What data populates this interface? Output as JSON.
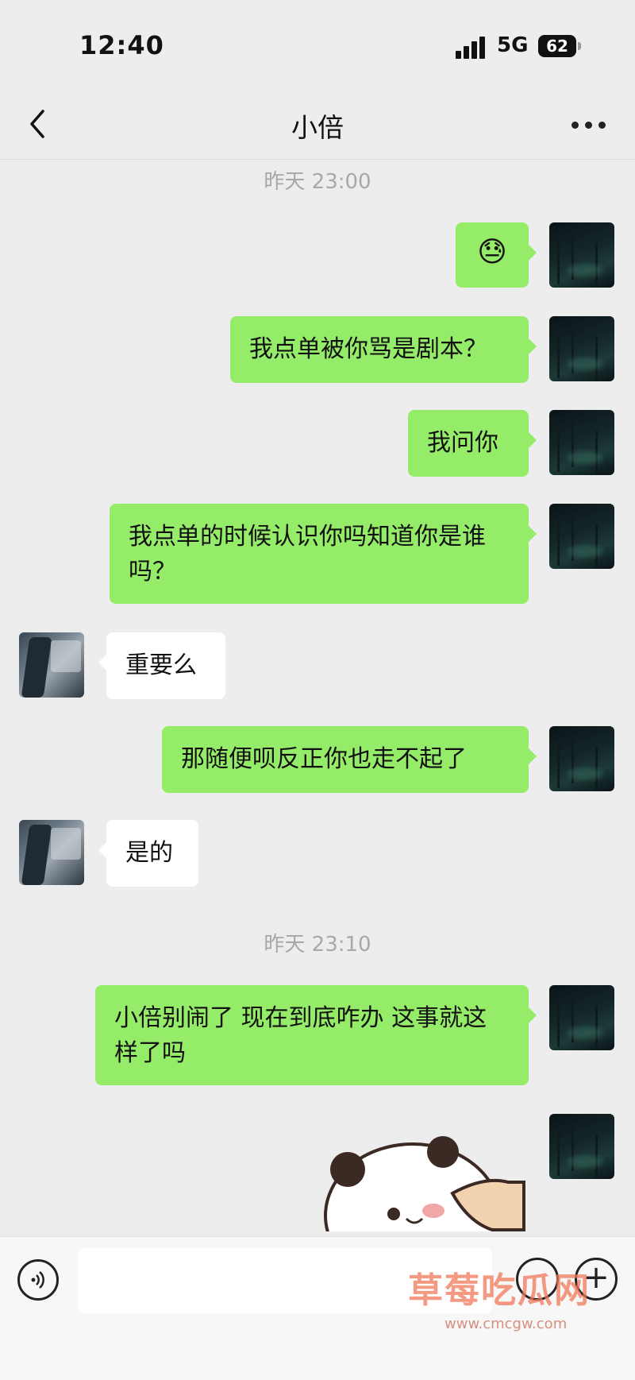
{
  "status_bar": {
    "time": "12:40",
    "network": "5G",
    "battery": "62"
  },
  "nav": {
    "title": "小倍",
    "back_icon": "chevron-left-icon",
    "more_icon": "more-dots-icon"
  },
  "messages": [
    {
      "type": "timestamp",
      "text": "昨天 23:00"
    },
    {
      "from": "self",
      "kind": "emoji",
      "text": "😓"
    },
    {
      "from": "self",
      "text": "我点单被你骂是剧本？"
    },
    {
      "from": "self",
      "text": "我问你"
    },
    {
      "from": "self",
      "text": "我点单的时候认识你吗知道你是谁吗？"
    },
    {
      "from": "other",
      "text": "重要么"
    },
    {
      "from": "self",
      "text": "那随便呗反正你也走不起了"
    },
    {
      "from": "other",
      "text": "是的"
    },
    {
      "type": "timestamp",
      "text": "昨天 23:10"
    },
    {
      "from": "self",
      "text": "小倍别闹了 现在到底咋办 这事就这样了吗"
    },
    {
      "from": "self",
      "kind": "sticker",
      "sticker": "panda-sticker"
    }
  ],
  "input_bar": {
    "value": "",
    "voice_icon": "voice-icon",
    "emoji_icon": "emoji-icon",
    "plus_icon": "plus-icon"
  },
  "watermark": {
    "text": "草莓吃瓜网",
    "url": "www.cmcgw.com"
  },
  "colors": {
    "self_bubble": "#95ec69",
    "other_bubble": "#ffffff",
    "background": "#ededed"
  }
}
